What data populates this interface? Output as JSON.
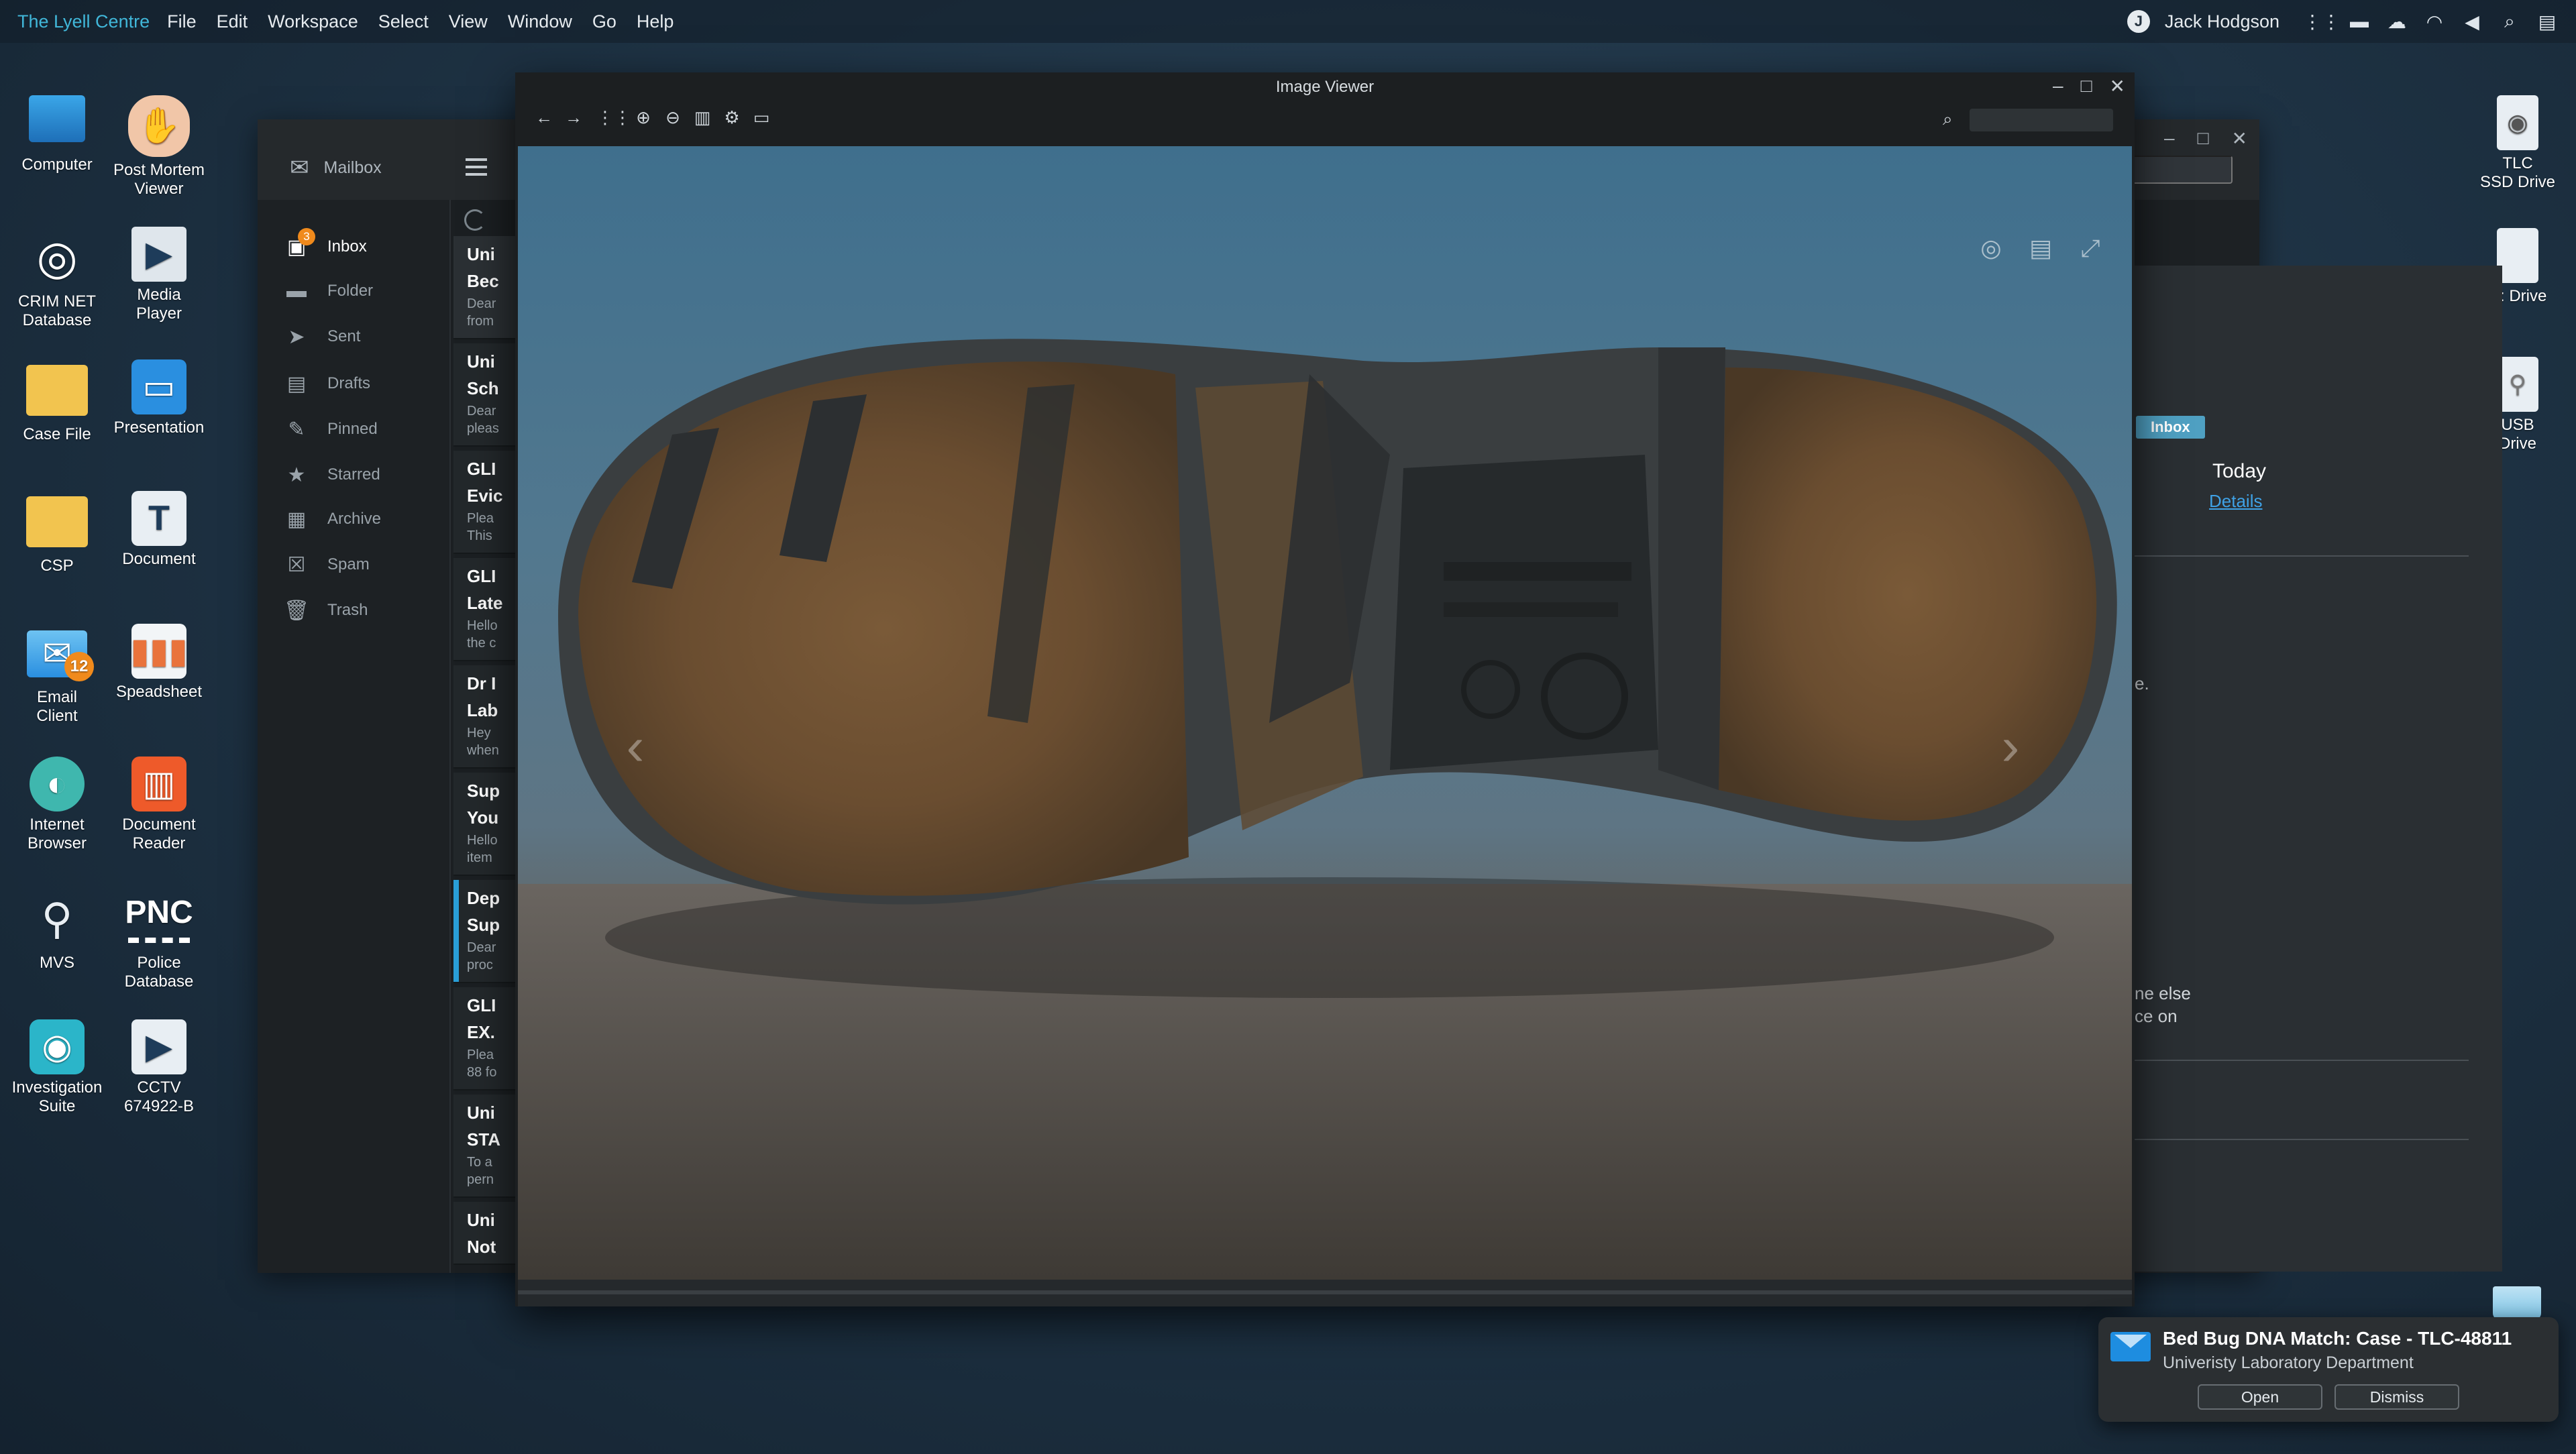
{
  "menubar": {
    "brand": "The Lyell Centre",
    "menus": [
      "File",
      "Edit",
      "Workspace",
      "Select",
      "View",
      "Window",
      "Go",
      "Help"
    ],
    "user": "Jack Hodgson",
    "tray_icons": [
      "apps-grid-icon",
      "folder-icon",
      "cloud-icon",
      "wifi-icon",
      "volume-icon",
      "search-icon",
      "notifications-icon"
    ]
  },
  "desktop": {
    "left_icons": [
      {
        "label1": "Computer",
        "label2": ""
      },
      {
        "label1": "Post Mortem",
        "label2": "Viewer"
      },
      {
        "label1": "CRIM NET",
        "label2": "Database"
      },
      {
        "label1": "Media",
        "label2": "Player"
      },
      {
        "label1": "Case File",
        "label2": ""
      },
      {
        "label1": "Presentation",
        "label2": ""
      },
      {
        "label1": "CSP",
        "label2": ""
      },
      {
        "label1": "Document",
        "label2": ""
      },
      {
        "label1": "Email",
        "label2": "Client",
        "badge": "12"
      },
      {
        "label1": "Speadsheet",
        "label2": ""
      },
      {
        "label1": "Internet",
        "label2": "Browser"
      },
      {
        "label1": "Document",
        "label2": "Reader"
      },
      {
        "label1": "MVS",
        "label2": ""
      },
      {
        "label1": "Police",
        "label2": "Database",
        "glyph_text": "PNC"
      },
      {
        "label1": "Investigation",
        "label2": "Suite"
      },
      {
        "label1": "CCTV",
        "label2": "674922-B"
      }
    ],
    "right_icons": [
      {
        "label1": "TLC",
        "label2": "SSD Drive"
      },
      {
        "label1": "C: Drive",
        "label2": ""
      },
      {
        "label1": "USB",
        "label2": "Drive"
      }
    ]
  },
  "mail": {
    "brand": "Mailbox",
    "folders": [
      {
        "label": "Inbox",
        "badge": "3"
      },
      {
        "label": "Folder"
      },
      {
        "label": "Sent"
      },
      {
        "label": "Drafts"
      },
      {
        "label": "Pinned"
      },
      {
        "label": "Starred"
      },
      {
        "label": "Archive"
      },
      {
        "label": "Spam"
      },
      {
        "label": "Trash"
      }
    ],
    "messages": [
      {
        "from": "Uni",
        "subject": "Bec",
        "preview1": "Dear",
        "preview2": "from"
      },
      {
        "from": "Uni",
        "subject": "Sch",
        "preview1": "Dear",
        "preview2": "pleas"
      },
      {
        "from": "GLI",
        "subject": "Evic",
        "preview1": "Plea",
        "preview2": "This"
      },
      {
        "from": "GLI",
        "subject": "Late",
        "preview1": "Hello",
        "preview2": "the c"
      },
      {
        "from": "Dr I",
        "subject": "Lab",
        "preview1": "Hey",
        "preview2": "when"
      },
      {
        "from": "Sup",
        "subject": "You",
        "preview1": "Hello",
        "preview2": "item"
      },
      {
        "from": "Dep",
        "subject": "Sup",
        "preview1": "Dear",
        "preview2": "proc"
      },
      {
        "from": "GLI",
        "subject": "EX.",
        "preview1": "Plea",
        "preview2": "88 fo"
      },
      {
        "from": "Uni",
        "subject": "STA",
        "preview1": "To a",
        "preview2": "pern"
      },
      {
        "from": "Uni",
        "subject": "Not",
        "preview1": "",
        "preview2": ""
      }
    ],
    "detail": {
      "tag": "Inbox",
      "date": "Today",
      "details_link": "Details",
      "text_fragment_1": "e.",
      "text_fragment_2a": "ne else",
      "text_fragment_2b": "ce on"
    }
  },
  "viewer": {
    "title": "Image Viewer",
    "toolbar_icons": [
      "back-icon",
      "forward-icon",
      "grid-icon",
      "zoom-in-icon",
      "zoom-out-icon",
      "delete-icon",
      "settings-icon",
      "slideshow-icon"
    ],
    "stage_icons": [
      "share-icon",
      "print-icon",
      "fullscreen-icon"
    ],
    "image_subject": "muddy boot sole"
  },
  "notification": {
    "title": "Bed Bug DNA Match: Case - TLC-48811",
    "subtitle": "Univeristy Laboratory Department",
    "open_label": "Open",
    "dismiss_label": "Dismiss"
  }
}
